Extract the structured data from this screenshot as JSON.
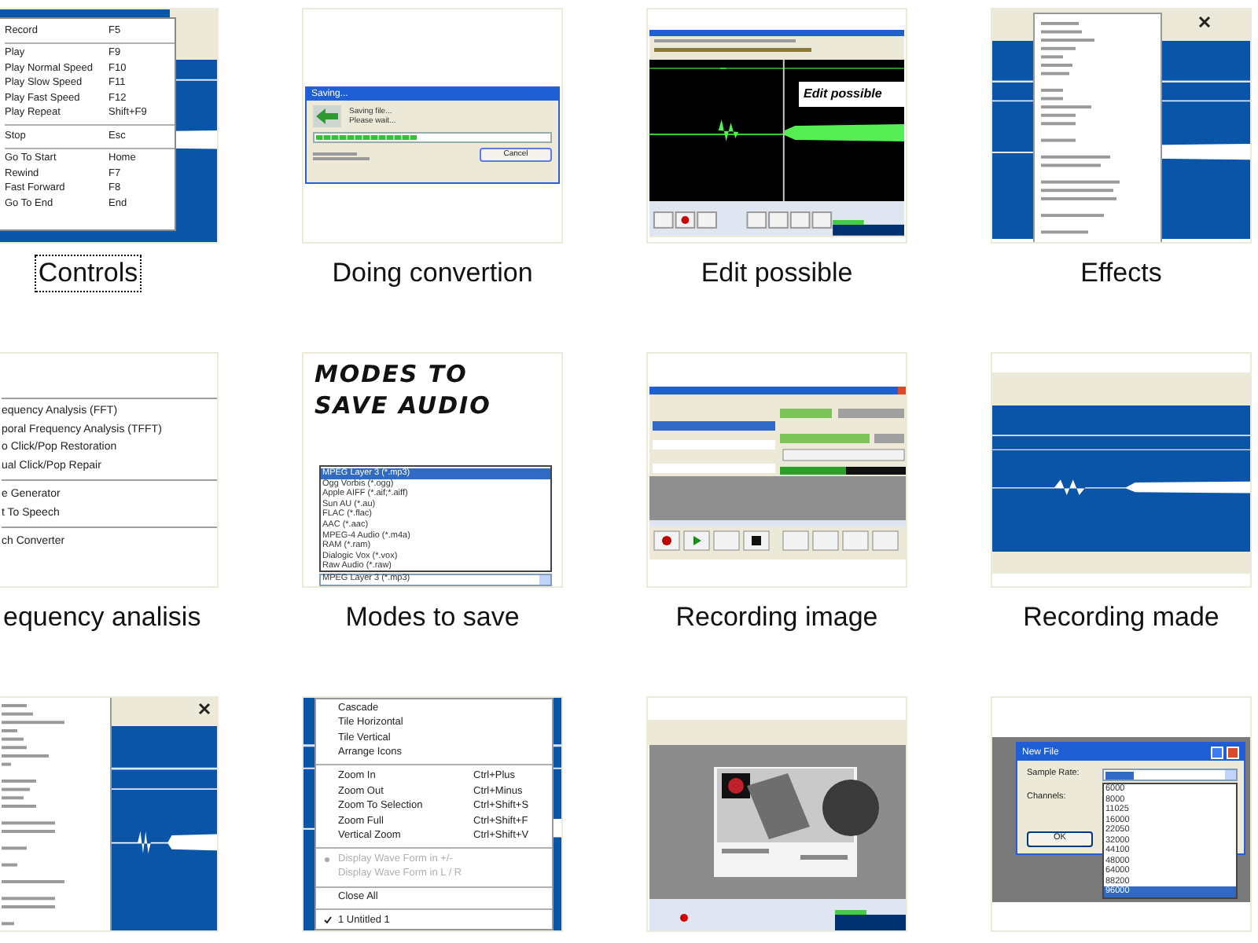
{
  "items": [
    {
      "label": "Controls",
      "selected": true,
      "thumbnail": {
        "kind": "controls_menu",
        "groups": [
          [
            {
              "text": "Record",
              "shortcut": "F5"
            }
          ],
          [
            {
              "text": "Play",
              "shortcut": "F9"
            },
            {
              "text": "Play Normal Speed",
              "shortcut": "F10"
            },
            {
              "text": "Play Slow Speed",
              "shortcut": "F11"
            },
            {
              "text": "Play Fast Speed",
              "shortcut": "F12"
            },
            {
              "text": "Play Repeat",
              "shortcut": "Shift+F9"
            }
          ],
          [
            {
              "text": "Stop",
              "shortcut": "Esc"
            }
          ],
          [
            {
              "text": "Go To Start",
              "shortcut": "Home"
            },
            {
              "text": "Rewind",
              "shortcut": "F7"
            },
            {
              "text": "Fast Forward",
              "shortcut": "F8"
            },
            {
              "text": "Go To End",
              "shortcut": "End"
            }
          ]
        ]
      }
    },
    {
      "label": "Doing convertion",
      "selected": false,
      "thumbnail": {
        "kind": "progress_dialog",
        "title": "Saving...",
        "message": [
          "Saving file...",
          "Please wait..."
        ],
        "level": 0.43,
        "button": "Cancel"
      }
    },
    {
      "label": "Edit possible",
      "selected": false,
      "thumbnail": {
        "kind": "edit_view",
        "caption": "Edit possible"
      }
    },
    {
      "label": "Effects",
      "selected": false,
      "thumbnail": {
        "kind": "effects_menu"
      }
    },
    {
      "label": "equency analisis",
      "selected": false,
      "thumbnail": {
        "kind": "analysis_menu",
        "groups": [
          [
            "equency Analysis (FFT)",
            "poral Frequency Analysis (TFFT)",
            "o Click/Pop Restoration",
            "ual Click/Pop Repair"
          ],
          [
            "e Generator",
            "t To Speech"
          ],
          [
            "ch Converter"
          ]
        ]
      }
    },
    {
      "label": "Modes to save",
      "selected": false,
      "thumbnail": {
        "kind": "format_list",
        "heading": [
          "MODES TO",
          "SAVE AUDIO"
        ],
        "formats": [
          {
            "text": "MPEG Layer 3 (*.mp3)",
            "selected": true
          },
          {
            "text": "Ogg Vorbis (*.ogg)",
            "selected": false
          },
          {
            "text": "Apple AIFF (*.aif;*.aiff)",
            "selected": false
          },
          {
            "text": "Sun AU (*.au)",
            "selected": false
          },
          {
            "text": "FLAC (*.flac)",
            "selected": false
          },
          {
            "text": "AAC (*.aac)",
            "selected": false
          },
          {
            "text": "MPEG-4 Audio (*.m4a)",
            "selected": false
          },
          {
            "text": "RAM (*.ram)",
            "selected": false
          },
          {
            "text": "Dialogic Vox (*.vox)",
            "selected": false
          },
          {
            "text": "Raw Audio (*.raw)",
            "selected": false
          }
        ],
        "value": "MPEG Layer 3 (*.mp3)"
      }
    },
    {
      "label": "Recording image",
      "selected": false,
      "thumbnail": {
        "kind": "recorder"
      }
    },
    {
      "label": "Recording made",
      "selected": false,
      "thumbnail": {
        "kind": "waveform_view"
      }
    },
    {
      "selected": false,
      "thumbnail": {
        "kind": "file_menu"
      }
    },
    {
      "selected": false,
      "thumbnail": {
        "kind": "window_menu",
        "groups": [
          [
            {
              "text": "Cascade",
              "checked": false,
              "disabled": false
            },
            {
              "text": "Tile Horizontal",
              "checked": false,
              "disabled": false
            },
            {
              "text": "Tile Vertical",
              "checked": false,
              "disabled": false
            },
            {
              "text": "Arrange Icons",
              "checked": false,
              "disabled": false
            }
          ],
          [
            {
              "text": "Zoom In",
              "shortcut": "Ctrl+Plus",
              "checked": false,
              "disabled": false
            },
            {
              "text": "Zoom Out",
              "shortcut": "Ctrl+Minus",
              "checked": false,
              "disabled": false
            },
            {
              "text": "Zoom To Selection",
              "shortcut": "Ctrl+Shift+S",
              "checked": false,
              "disabled": false
            },
            {
              "text": "Zoom Full",
              "shortcut": "Ctrl+Shift+F",
              "checked": false,
              "disabled": false
            },
            {
              "text": "Vertical Zoom",
              "shortcut": "Ctrl+Shift+V",
              "checked": false,
              "disabled": false
            }
          ],
          [
            {
              "text": "Display Wave Form in +/-",
              "checked": true,
              "disabled": true
            },
            {
              "text": "Display Wave Form in L / R",
              "checked": false,
              "disabled": true
            }
          ],
          [
            {
              "text": "Close All",
              "checked": false,
              "disabled": false
            }
          ],
          [
            {
              "text": "1 Untitled 1",
              "checked": true,
              "disabled": false
            }
          ]
        ]
      }
    },
    {
      "selected": false,
      "thumbnail": {
        "kind": "splash"
      }
    },
    {
      "selected": false,
      "thumbnail": {
        "kind": "new_file_dialog",
        "title": "New File",
        "fields": [
          "Sample Rate:",
          "Channels:"
        ],
        "button": "OK",
        "rates": [
          {
            "text": "6000",
            "selected": false
          },
          {
            "text": "8000",
            "selected": false
          },
          {
            "text": "11025",
            "selected": false
          },
          {
            "text": "16000",
            "selected": false
          },
          {
            "text": "22050",
            "selected": false
          },
          {
            "text": "32000",
            "selected": false
          },
          {
            "text": "44100",
            "selected": false
          },
          {
            "text": "48000",
            "selected": false
          },
          {
            "text": "64000",
            "selected": false
          },
          {
            "text": "88200",
            "selected": false
          },
          {
            "text": "96000",
            "selected": true
          }
        ]
      }
    }
  ]
}
